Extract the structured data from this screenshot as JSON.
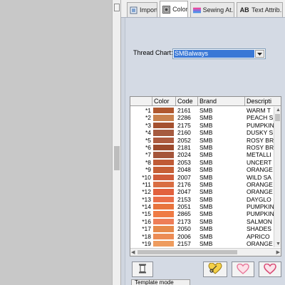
{
  "tabs": [
    {
      "label": "Import",
      "icon": "import-icon"
    },
    {
      "label": "Color",
      "icon": "color-icon",
      "active": true
    },
    {
      "label": "Sewing At...",
      "icon": "sewing-icon"
    },
    {
      "label": "Text Attrib...",
      "icon": "text-icon",
      "icon_text": "AB"
    }
  ],
  "thread_chart": {
    "label": "Thread Chart:",
    "value": "SMBalways"
  },
  "grid": {
    "columns": [
      "",
      "Color",
      "Code",
      "Brand",
      "Descripti"
    ],
    "rows": [
      {
        "num": "*1",
        "color": "#b0582f",
        "code": "2161",
        "brand": "SMB",
        "desc": "WARM T"
      },
      {
        "num": "*2",
        "color": "#c9824f",
        "code": "2286",
        "brand": "SMB",
        "desc": "PEACH S"
      },
      {
        "num": "*3",
        "color": "#a5512f",
        "code": "2175",
        "brand": "SMB",
        "desc": "PUMPKIN"
      },
      {
        "num": "*4",
        "color": "#a65a3f",
        "code": "2160",
        "brand": "SMB",
        "desc": "DUSKY S"
      },
      {
        "num": "*5",
        "color": "#ad5b40",
        "code": "2052",
        "brand": "SMB",
        "desc": "ROSY BR"
      },
      {
        "num": "*6",
        "color": "#9c4a2d",
        "code": "2181",
        "brand": "SMB",
        "desc": "ROSY BR"
      },
      {
        "num": "*7",
        "color": "#a5553a",
        "code": "2024",
        "brand": "SMB",
        "desc": "METALLI"
      },
      {
        "num": "*8",
        "color": "#c05a35",
        "code": "2053",
        "brand": "SMB",
        "desc": "UNCERT"
      },
      {
        "num": "*9",
        "color": "#c65f36",
        "code": "2048",
        "brand": "SMB",
        "desc": "ORANGE"
      },
      {
        "num": "*10",
        "color": "#d05d3b",
        "code": "2007",
        "brand": "SMB",
        "desc": "WILD SA"
      },
      {
        "num": "*11",
        "color": "#d96d42",
        "code": "2176",
        "brand": "SMB",
        "desc": "ORANGE"
      },
      {
        "num": "*12",
        "color": "#e2613e",
        "code": "2047",
        "brand": "SMB",
        "desc": "ORANGE"
      },
      {
        "num": "*13",
        "color": "#ea6f4a",
        "code": "2153",
        "brand": "SMB",
        "desc": "DAYGLO"
      },
      {
        "num": "*14",
        "color": "#e8743d",
        "code": "2051",
        "brand": "SMB",
        "desc": "PUMPKIN"
      },
      {
        "num": "*15",
        "color": "#ef7b45",
        "code": "2865",
        "brand": "SMB",
        "desc": "PUMPKIN"
      },
      {
        "num": "*16",
        "color": "#ee7e58",
        "code": "2173",
        "brand": "SMB",
        "desc": "SALMON"
      },
      {
        "num": "*17",
        "color": "#e68a4c",
        "code": "2050",
        "brand": "SMB",
        "desc": "SHADES"
      },
      {
        "num": "*18",
        "color": "#ec8c55",
        "code": "2006",
        "brand": "SMB",
        "desc": "APRICO"
      },
      {
        "num": "*19",
        "color": "#ee9c5e",
        "code": "2157",
        "brand": "SMB",
        "desc": "ORANGE"
      }
    ]
  },
  "bottom_tab": {
    "label": "Template mode"
  }
}
